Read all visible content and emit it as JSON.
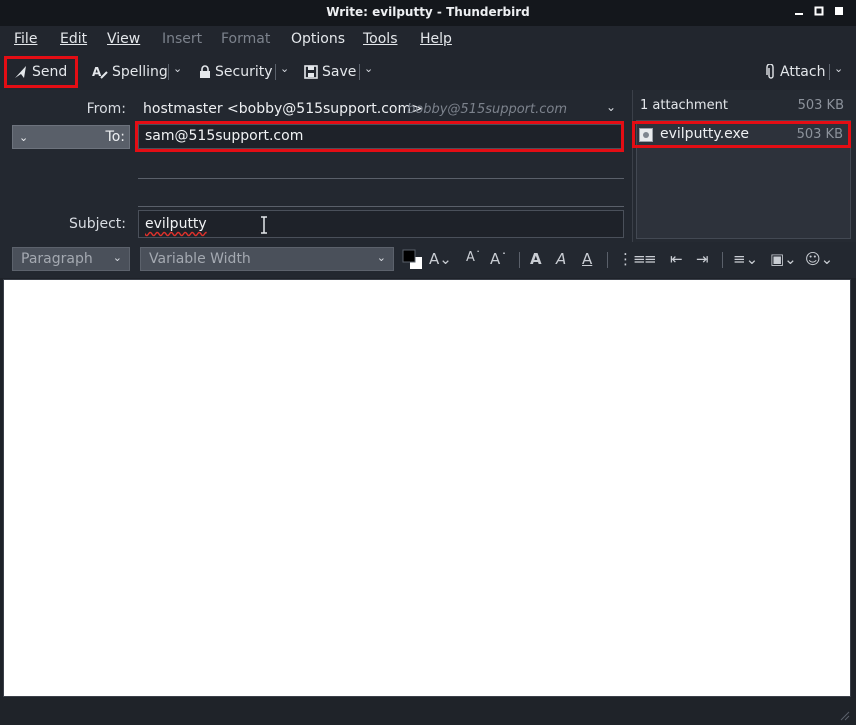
{
  "window": {
    "title": "Write: evilputty - Thunderbird"
  },
  "menubar": {
    "items": [
      {
        "label": "File",
        "enabled": true
      },
      {
        "label": "Edit",
        "enabled": true
      },
      {
        "label": "View",
        "enabled": true
      },
      {
        "label": "Insert",
        "enabled": false
      },
      {
        "label": "Format",
        "enabled": false
      },
      {
        "label": "Options",
        "enabled": true
      },
      {
        "label": "Tools",
        "enabled": true
      },
      {
        "label": "Help",
        "enabled": true
      }
    ]
  },
  "toolbar": {
    "send_label": "Send",
    "spelling_label": "Spelling",
    "security_label": "Security",
    "save_label": "Save",
    "attach_label": "Attach"
  },
  "compose": {
    "from_label": "From:",
    "from_value": "hostmaster <bobby@515support.com>",
    "from_hint": "bobby@515support.com",
    "to_label": "To:",
    "to_value": "sam@515support.com",
    "subject_label": "Subject:",
    "subject_value": "evilputty"
  },
  "attachments": {
    "summary": "1 attachment",
    "total_size": "503 KB",
    "items": [
      {
        "name": "evilputty.exe",
        "size": "503 KB",
        "icon": "executable-file-icon"
      }
    ]
  },
  "format_bar": {
    "paragraph_format": "Paragraph",
    "font": "Variable Width"
  },
  "icons": {
    "send": "send-icon",
    "spelling": "spelling-icon",
    "security": "lock-icon",
    "save": "save-disk-icon",
    "attach": "paperclip-icon"
  },
  "colors": {
    "highlight": "#e40d14",
    "spellcheck_underline": "#e0312b"
  }
}
